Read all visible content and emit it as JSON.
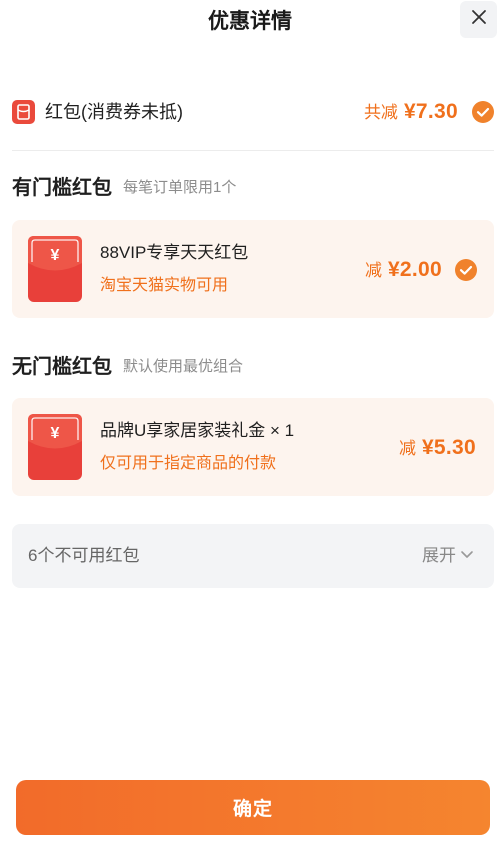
{
  "header": {
    "title": "优惠详情",
    "close_icon": "close-icon"
  },
  "summary": {
    "icon": "red-packet-icon",
    "label": "红包(消费券未抵)",
    "total_prefix": "共减",
    "total_amount": "¥7.30",
    "checked": true
  },
  "sections": [
    {
      "title": "有门槛红包",
      "subtitle": "每笔订单限用1个",
      "items": [
        {
          "icon": "envelope-icon",
          "icon_symbol": "¥",
          "name": "88VIP专享天天红包",
          "desc": "淘宝天猫实物可用",
          "discount_prefix": "减",
          "discount_amount": "¥2.00",
          "checked": true
        }
      ]
    },
    {
      "title": "无门槛红包",
      "subtitle": "默认使用最优组合",
      "items": [
        {
          "icon": "envelope-icon",
          "icon_symbol": "¥",
          "name": "品牌U享家居家装礼金 × 1",
          "desc": "仅可用于指定商品的付款",
          "discount_prefix": "减",
          "discount_amount": "¥5.30",
          "checked": false
        }
      ]
    }
  ],
  "unavailable": {
    "label": "6个不可用红包",
    "expand_label": "展开",
    "expand_icon": "chevron-down-icon"
  },
  "confirm_button": {
    "label": "确定"
  },
  "colors": {
    "accent": "#f0701c",
    "check": "#f0822c",
    "envelope_red": "#e8403a",
    "card_bg": "#fdf4ee",
    "muted_bar_bg": "#f3f4f6",
    "button": "#f3762c"
  }
}
